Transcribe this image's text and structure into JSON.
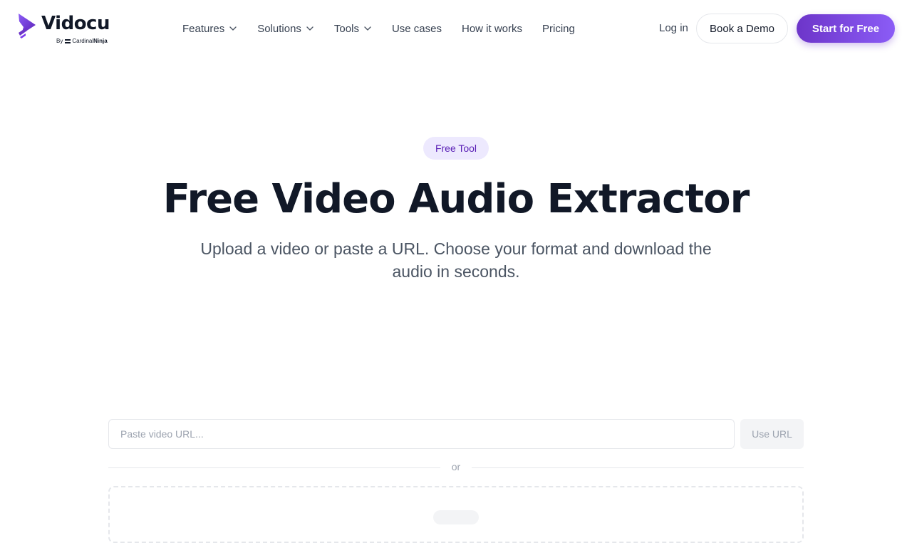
{
  "header": {
    "logo": {
      "name": "Vidocu",
      "by": "By",
      "brand_a": "Cardinal",
      "brand_b": "Ninja"
    },
    "nav": [
      {
        "label": "Features",
        "dropdown": true
      },
      {
        "label": "Solutions",
        "dropdown": true
      },
      {
        "label": "Tools",
        "dropdown": true
      },
      {
        "label": "Use cases",
        "dropdown": false
      },
      {
        "label": "How it works",
        "dropdown": false
      },
      {
        "label": "Pricing",
        "dropdown": false
      }
    ],
    "login_label": "Log in",
    "demo_label": "Book a Demo",
    "start_label": "Start for Free"
  },
  "hero": {
    "badge": "Free Tool",
    "title": "Free Video Audio Extractor",
    "subtitle": "Upload a video or paste a URL. Choose your format and download the audio in seconds."
  },
  "tool": {
    "url_placeholder": "Paste video URL...",
    "url_value": "",
    "use_url_label": "Use URL",
    "or_label": "or"
  },
  "colors": {
    "accent": "#6d35c9",
    "accent_light": "#8b5cf6",
    "badge_bg": "#ede9fe",
    "text": "#111827"
  },
  "icons": {
    "logo": "play-triangle-logo-icon",
    "dropdown": "chevron-down-icon"
  }
}
